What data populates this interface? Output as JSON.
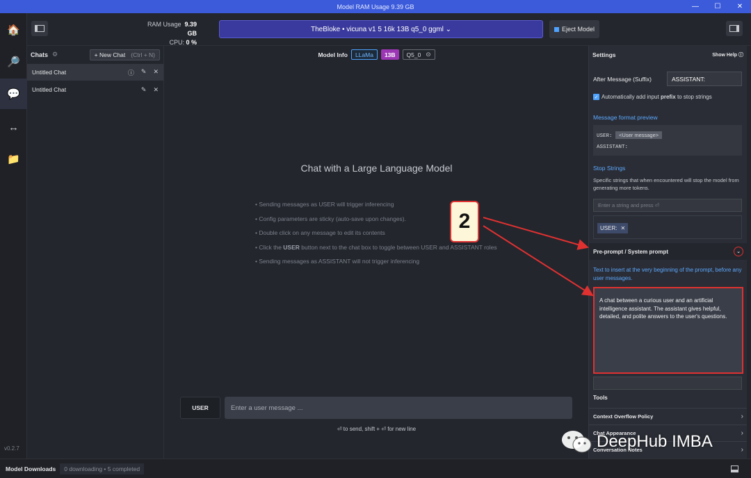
{
  "titlebar": {
    "title": "Model RAM Usage  9.39 GB",
    "buttons": {
      "minimize": "—",
      "maximize": "☐",
      "close": "✕"
    }
  },
  "nav": {
    "items": [
      {
        "name": "home",
        "icon": "🏠"
      },
      {
        "name": "search",
        "icon": "🔎"
      },
      {
        "name": "chat",
        "icon": "💬"
      },
      {
        "name": "server",
        "icon": "↔"
      },
      {
        "name": "folder",
        "icon": "📁"
      }
    ],
    "version": "v0.2.7"
  },
  "topbar": {
    "ram_label": "RAM Usage",
    "ram_value": "9.39 GB",
    "cpu_label": "CPU:",
    "cpu_value": "0 %",
    "model_name": "TheBloke • vicuna v1 5 16k 13B q5_0 ggml ⌄",
    "eject_label": "Eject Model"
  },
  "chats": {
    "title": "Chats",
    "gear": "⚙",
    "new_chat": "+ New Chat",
    "new_chat_shortcut": "(Ctrl + N)",
    "items": [
      {
        "label": "Untitled Chat",
        "info": "ⓘ",
        "edit": "✎",
        "close": "✕"
      },
      {
        "label": "Untitled Chat",
        "edit": "✎",
        "close": "✕"
      }
    ]
  },
  "main": {
    "model_info_label": "Model Info",
    "tags": {
      "arch": "LLaMa",
      "size": "13B",
      "quant": "Q5_0",
      "quant_icon": "⊙"
    },
    "title": "Chat with a Large Language Model",
    "hints": {
      "h1": "• Sending messages as USER will trigger inferencing",
      "h2": "• Config parameters are sticky (auto-save upon changes).",
      "h3": "• Double click on any message to edit its contents",
      "h4_pre": "• Click the ",
      "h4_bold": "USER",
      "h4_post": " button next to the chat box to toggle between USER and ASSISTANT roles",
      "h5": "• Sending messages as ASSISTANT will not trigger inferencing"
    },
    "role_button": "USER",
    "input_placeholder": "Enter a user message ...",
    "send_hint": "⏎ to send, shift + ⏎ for new line"
  },
  "settings": {
    "title": "Settings",
    "show_help": "Show Help ⓘ",
    "suffix_label": "After Message (Suffix)",
    "suffix_value": "ASSISTANT:",
    "auto_prefix_pre": "Automatically add input ",
    "auto_prefix_bold": "prefix",
    "auto_prefix_post": " to stop strings",
    "mfp_label": "Message format preview",
    "mfp_user": "USER:",
    "mfp_chip": "<User message>",
    "mfp_assistant": "ASSISTANT:",
    "stop_label": "Stop Strings",
    "stop_desc": "Specific strings that when encountered will stop the model from generating more tokens.",
    "stop_placeholder": "Enter a string and press ⏎",
    "stop_chip": "USER:",
    "stop_chip_x": "✕",
    "preprompt_title": "Pre-prompt / System prompt",
    "preprompt_desc": "Text to insert at the very beginning of the prompt, before any user messages.",
    "preprompt_value": "A chat between a curious user and an artificial intelligence assistant. The assistant gives helpful, detailed, and polite answers to the user's questions.",
    "tools_label": "Tools",
    "tool_items": [
      "Context Overflow Policy",
      "Chat Appearance",
      "Conversation Notes"
    ]
  },
  "bottombar": {
    "label": "Model Downloads",
    "status": "0 downloading • 5 completed"
  },
  "annotations": {
    "badge": "2",
    "watermark": "DeepHub IMBA",
    "arrow_color": "#e03131"
  }
}
